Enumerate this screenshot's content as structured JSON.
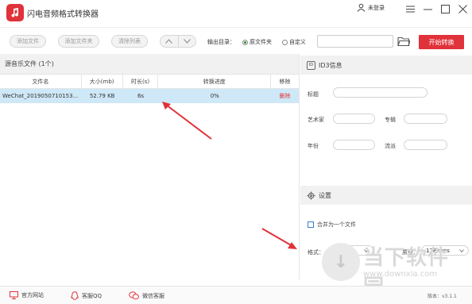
{
  "app": {
    "title": "闪电音频格式转换器",
    "user": "未登录"
  },
  "toolbar": {
    "add_file": "添加文件",
    "add_folder": "添加文件夹",
    "clear_list": "清除列表",
    "output_dir_label": "输出目录：",
    "radio_source": "原文件夹",
    "radio_custom": "自定义",
    "output_path_value": "",
    "start_label": "开始转换"
  },
  "source_list": {
    "header": "源音乐文件 (1个)",
    "columns": [
      "文件名",
      "大小(mb)",
      "时长(s)",
      "转换进度",
      "移除"
    ],
    "rows": [
      {
        "name": "WeChat_2019050710153...",
        "size": "52.79 KB",
        "duration": "6s",
        "progress": "0%",
        "remove": "删除"
      }
    ]
  },
  "id3": {
    "title": "ID3信息",
    "title_label": "标题",
    "artist_label": "艺术家",
    "album_label": "专辑",
    "year_label": "年份",
    "genre_label": "流派"
  },
  "settings": {
    "title": "设置",
    "merge_label": "合并为一个文件",
    "format_label": "格式：",
    "format_value": "mp3",
    "quality_label": "质量：",
    "quality_value": "128kbps"
  },
  "footer": {
    "website": "官方网站",
    "qq": "客服QQ",
    "wechat": "微信客服",
    "version": "版本：v3.1.1"
  },
  "watermark": {
    "text": "当下软件园",
    "url": "www.downxia.com"
  },
  "colors": {
    "accent": "#e0323a",
    "selected_row": "#cfe8f7",
    "panel_header": "#f1f1f1"
  }
}
